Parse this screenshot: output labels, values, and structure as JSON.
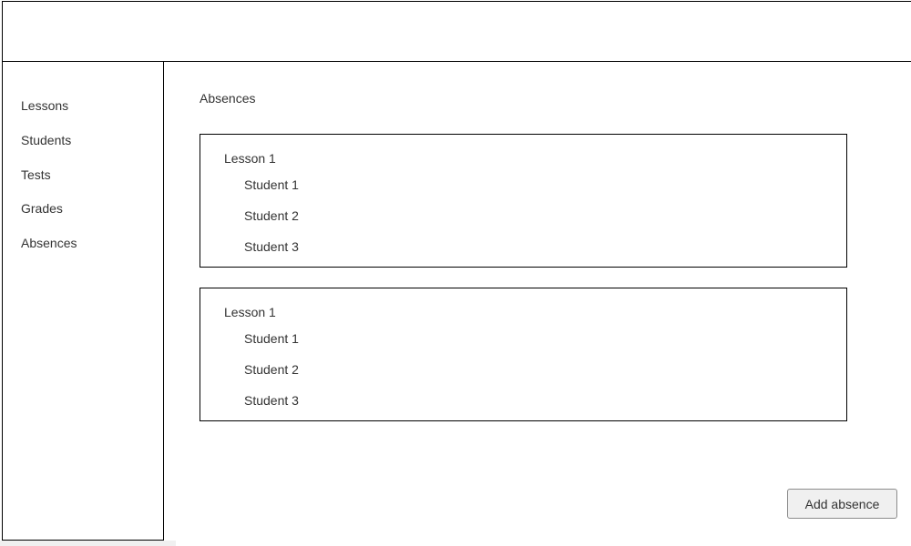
{
  "sidebar": {
    "items": [
      {
        "label": "Lessons"
      },
      {
        "label": "Students"
      },
      {
        "label": "Tests"
      },
      {
        "label": "Grades"
      },
      {
        "label": "Absences"
      }
    ]
  },
  "main": {
    "title": "Absences",
    "lessons": [
      {
        "title": "Lesson 1",
        "students": [
          "Student 1",
          "Student 2",
          "Student 3"
        ]
      },
      {
        "title": "Lesson 1",
        "students": [
          "Student 1",
          "Student 2",
          "Student 3"
        ]
      }
    ],
    "add_button_label": "Add absence"
  }
}
